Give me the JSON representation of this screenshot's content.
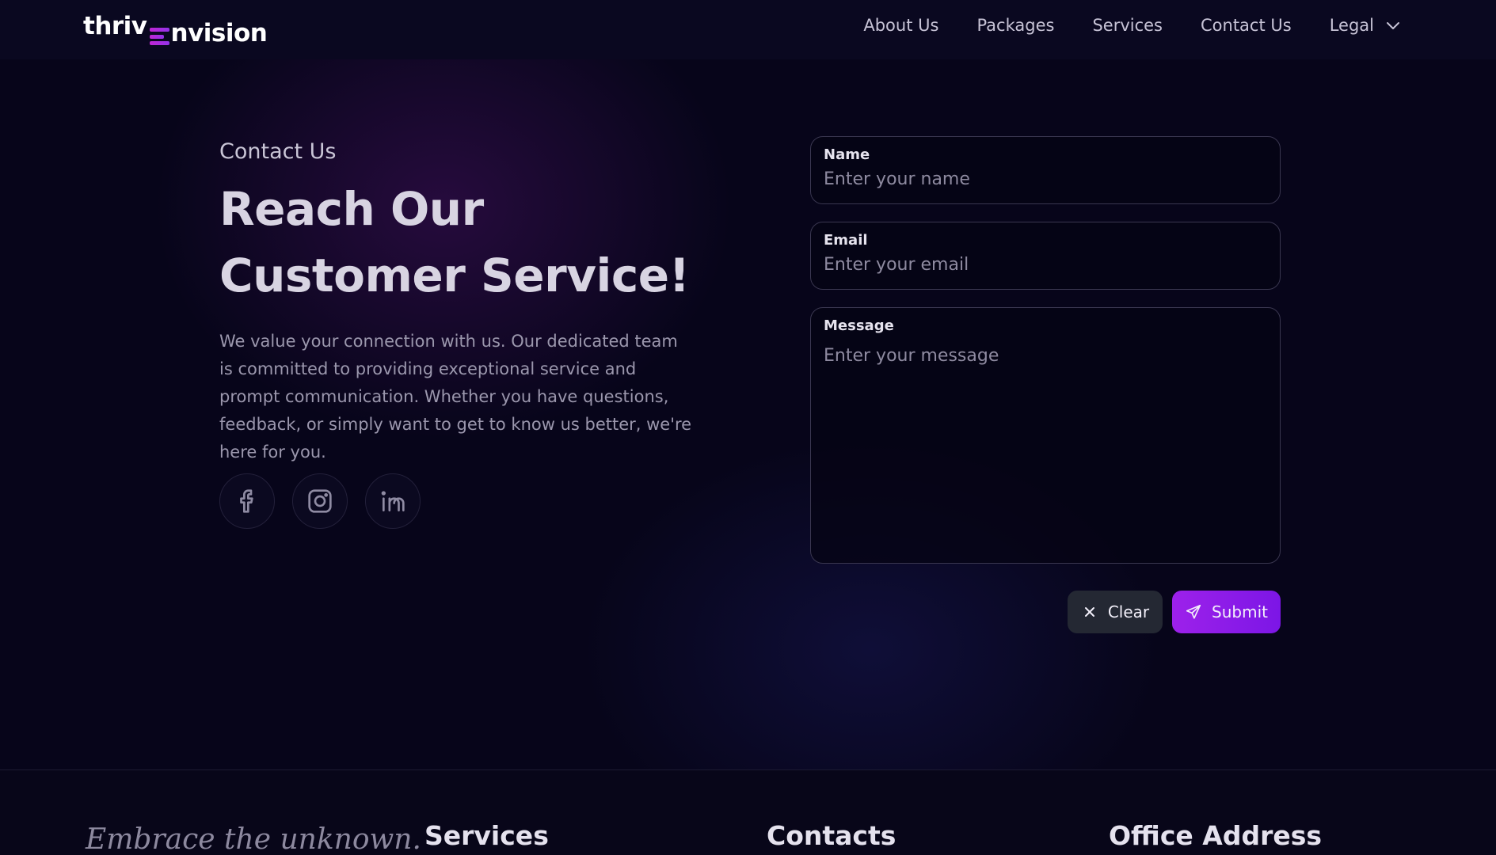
{
  "brand": {
    "logo_part1": "thriv",
    "logo_part2": "nvision",
    "accent": "#9d21ea"
  },
  "nav": {
    "items": [
      {
        "label": "About Us"
      },
      {
        "label": "Packages"
      },
      {
        "label": "Services"
      },
      {
        "label": "Contact Us"
      },
      {
        "label": "Legal",
        "icon": "chevron-down-icon"
      }
    ]
  },
  "contact": {
    "eyebrow": "Contact Us",
    "headline": "Reach Our Customer Service!",
    "description": "We value your connection with us. Our dedicated team is committed to providing exceptional service and prompt communication. Whether you have questions, feedback, or simply want to get to know us better, we're here for you.",
    "socials": [
      "facebook-icon",
      "instagram-icon",
      "linkedin-icon"
    ]
  },
  "form": {
    "name_label": "Name",
    "name_placeholder": "Enter your name",
    "email_label": "Email",
    "email_placeholder": "Enter your email",
    "message_label": "Message",
    "message_placeholder": "Enter your message",
    "clear_label": "Clear",
    "submit_label": "Submit"
  },
  "footer": {
    "tagline": "Embrace the unknown.",
    "services_heading": "Services",
    "contacts_heading": "Contacts",
    "office_heading": "Office Address"
  }
}
